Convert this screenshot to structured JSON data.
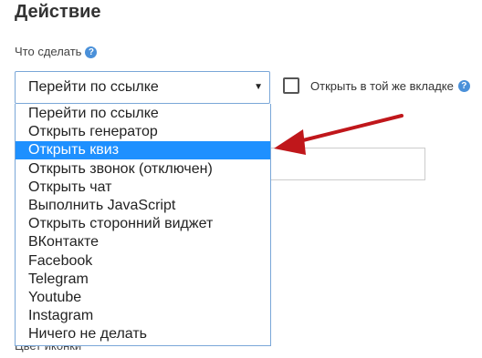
{
  "section": {
    "title": "Действие",
    "field_label": "Что сделать",
    "help_glyph": "?"
  },
  "select": {
    "value": "Перейти по ссылке",
    "arrow_glyph": "▼"
  },
  "checkbox": {
    "label": "Открыть в той же вкладке",
    "checked": false
  },
  "dropdown": {
    "options": [
      "Перейти по ссылке",
      "Открыть генератор",
      "Открыть квиз",
      "Открыть звонок (отключен)",
      "Открыть чат",
      "Выполнить JavaScript",
      "Открыть сторонний виджет",
      "ВКонтакте",
      "Facebook",
      "Telegram",
      "Youtube",
      "Instagram",
      "Ничего не делать"
    ],
    "highlighted": "Открыть квиз"
  },
  "below_label": "Цвет иконки",
  "colors": {
    "highlight": "#1e90ff",
    "arrow": "#c0171b",
    "help": "#4a90d9"
  }
}
